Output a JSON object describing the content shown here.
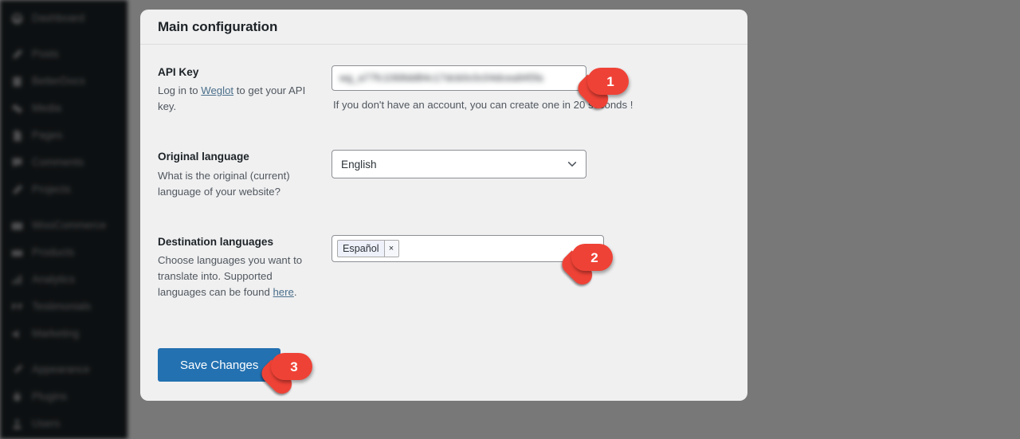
{
  "sidebar": {
    "items": [
      {
        "label": "Dashboard",
        "icon": "dashboard-icon"
      },
      {
        "label": "Posts",
        "icon": "pin-icon"
      },
      {
        "label": "BetterDocs",
        "icon": "book-icon"
      },
      {
        "label": "Media",
        "icon": "media-icon"
      },
      {
        "label": "Pages",
        "icon": "page-icon"
      },
      {
        "label": "Comments",
        "icon": "comment-icon"
      },
      {
        "label": "Projects",
        "icon": "pin-icon"
      },
      {
        "label": "WooCommerce",
        "icon": "store-icon"
      },
      {
        "label": "Products",
        "icon": "products-icon"
      },
      {
        "label": "Analytics",
        "icon": "chart-icon"
      },
      {
        "label": "Testimonials",
        "icon": "quote-icon"
      },
      {
        "label": "Marketing",
        "icon": "megaphone-icon"
      },
      {
        "label": "Appearance",
        "icon": "brush-icon"
      },
      {
        "label": "Plugins",
        "icon": "plug-icon"
      },
      {
        "label": "Users",
        "icon": "users-icon"
      }
    ]
  },
  "card": {
    "title": "Main configuration"
  },
  "api_key": {
    "label": "API Key",
    "desc_before": "Log in to ",
    "desc_link": "Weglot",
    "desc_after": " to get your API key.",
    "value": "wg_a77fc1068dd84c17dcb0c0c04dcea945fa",
    "placeholder": "",
    "note": "If you don't have an account, you can create one in 20 seconds !"
  },
  "original_language": {
    "label": "Original language",
    "desc": "What is the original (current) language of your website?",
    "selected": "English",
    "options": [
      "English"
    ]
  },
  "destination_languages": {
    "label": "Destination languages",
    "desc_before": "Choose languages you want to translate into. Supported languages can be found ",
    "desc_link": "here",
    "desc_after": ".",
    "chips": [
      {
        "label": "Español",
        "remove": "×"
      }
    ]
  },
  "actions": {
    "save_label": "Save Changes"
  },
  "markers": [
    {
      "number": "1"
    },
    {
      "number": "2"
    },
    {
      "number": "3"
    }
  ],
  "colors": {
    "accent_blue": "#2371b1",
    "marker_red": "#ef4236",
    "card_bg": "#f0f0f1",
    "sidebar_bg": "#1d2327"
  }
}
